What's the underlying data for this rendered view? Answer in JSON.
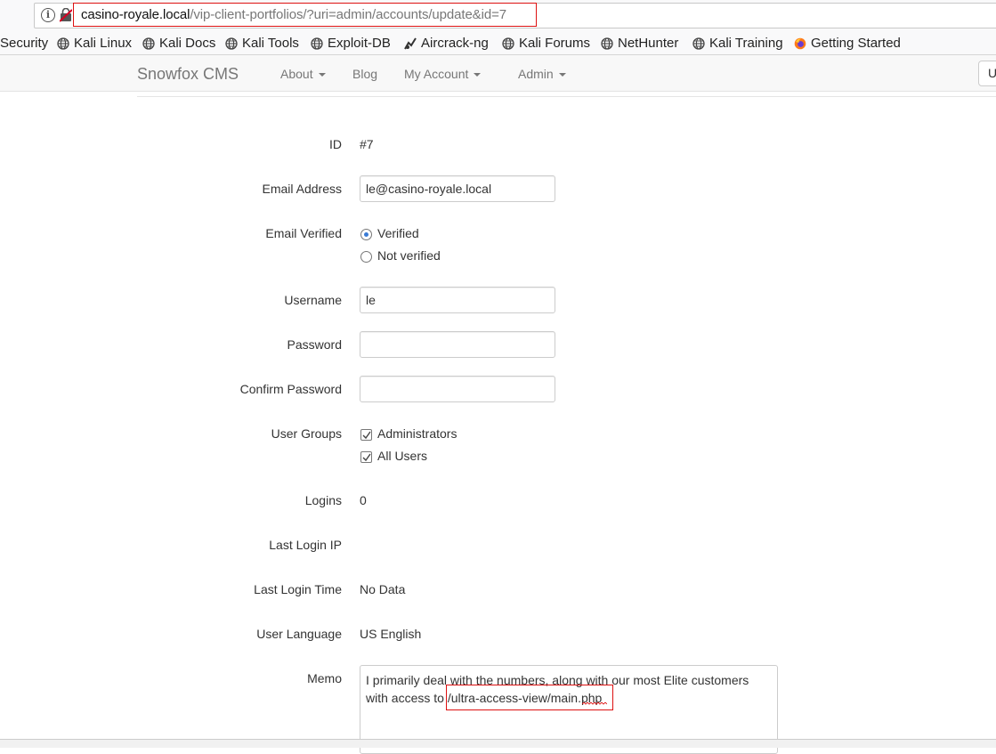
{
  "browser": {
    "url_host": "casino-royale.local",
    "url_path": "/vip-client-portfolios/?uri=admin/accounts/update&id=7"
  },
  "bookmarks": [
    {
      "label": "Security",
      "icon": "none"
    },
    {
      "label": "Kali Linux",
      "icon": "globe-icon"
    },
    {
      "label": "Kali Docs",
      "icon": "globe-icon"
    },
    {
      "label": "Kali Tools",
      "icon": "globe-icon"
    },
    {
      "label": "Exploit-DB",
      "icon": "globe-icon"
    },
    {
      "label": "Aircrack-ng",
      "icon": "aircrack-icon"
    },
    {
      "label": "Kali Forums",
      "icon": "globe-icon"
    },
    {
      "label": "NetHunter",
      "icon": "globe-icon"
    },
    {
      "label": "Kali Training",
      "icon": "globe-icon"
    },
    {
      "label": "Getting Started",
      "icon": "firefox-icon"
    }
  ],
  "navbar": {
    "brand": "Snowfox CMS",
    "about": "About",
    "blog": "Blog",
    "my_account": "My Account",
    "admin": "Admin",
    "right_input": "U"
  },
  "form": {
    "id_label": "ID",
    "id_value": "#7",
    "email_label": "Email Address",
    "email_value": "le@casino-royale.local",
    "verified_label": "Email Verified",
    "verified_option": "Verified",
    "not_verified_option": "Not verified",
    "username_label": "Username",
    "username_value": "le",
    "password_label": "Password",
    "password_value": "",
    "confirm_label": "Confirm Password",
    "confirm_value": "",
    "groups_label": "User Groups",
    "group_admins": "Administrators",
    "group_all": "All Users",
    "logins_label": "Logins",
    "logins_value": "0",
    "last_ip_label": "Last Login IP",
    "last_ip_value": "",
    "last_time_label": "Last Login Time",
    "last_time_value": "No Data",
    "language_label": "User Language",
    "language_value": "US English",
    "memo_label": "Memo",
    "memo_text": "I primarily deal with the numbers, along with our most Elite customers with access to ",
    "memo_path": "/ultra-access-view/main.php"
  },
  "colors": {
    "highlight_box": "#dd1111",
    "radio_selected": "#3a7bd5"
  }
}
